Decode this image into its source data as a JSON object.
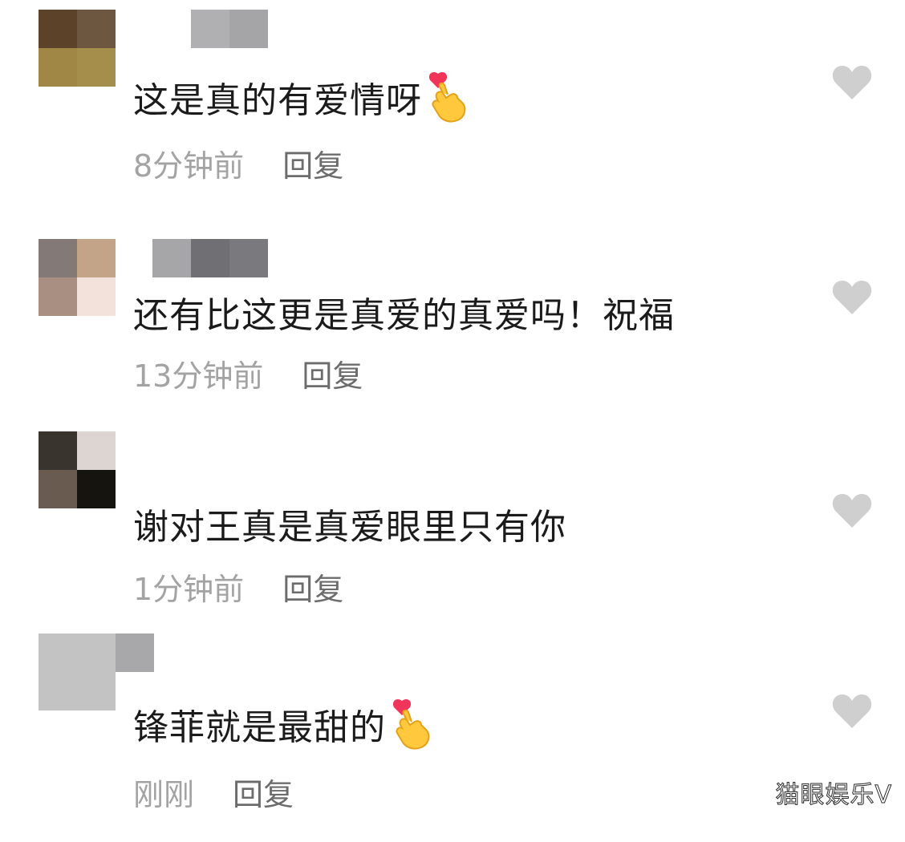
{
  "comments": [
    {
      "text": "这是真的有爱情呀",
      "time": "8分钟前",
      "reply_label": "回复",
      "has_emoji": true,
      "avatar_colors": [
        "#5c4229",
        "#6d5741",
        "#a08746",
        "#a58d4c"
      ],
      "username_colors": [
        "#b0b0b2",
        "#a5a5a7"
      ]
    },
    {
      "text": "还有比这更是真爱的真爱吗！祝福",
      "time": "13分钟前",
      "reply_label": "回复",
      "has_emoji": false,
      "avatar_colors": [
        "#837977",
        "#c3a489",
        "#a88f82",
        "#f2e2db"
      ],
      "username_colors": [
        "#a6a6a8",
        "#6f6f74",
        "#7a7a7e"
      ]
    },
    {
      "text": "谢对王真是真爱眼里只有你",
      "time": "1分钟前",
      "reply_label": "回复",
      "has_emoji": false,
      "avatar_colors": [
        "#3a342f",
        "#dcd5d1",
        "#6a5b50",
        "#15140f"
      ],
      "username_colors": []
    },
    {
      "text": "锋菲就是最甜的",
      "time": "刚刚",
      "reply_label": "回复",
      "has_emoji": true,
      "avatar_colors": [
        "#c3c3c3",
        "#c3c3c3",
        "#c3c3c3",
        "#c3c3c3"
      ],
      "username_colors": [
        "#a8a8ab"
      ]
    }
  ],
  "icons": {
    "like": "heart-icon",
    "emoji": "finger-heart-emoji-icon"
  },
  "colors": {
    "text": "#1b1b1b",
    "time": "#a3a3a3",
    "reply": "#6c6c6c",
    "heart": "#cfcfcf"
  },
  "watermark": "猫眼娱乐V"
}
